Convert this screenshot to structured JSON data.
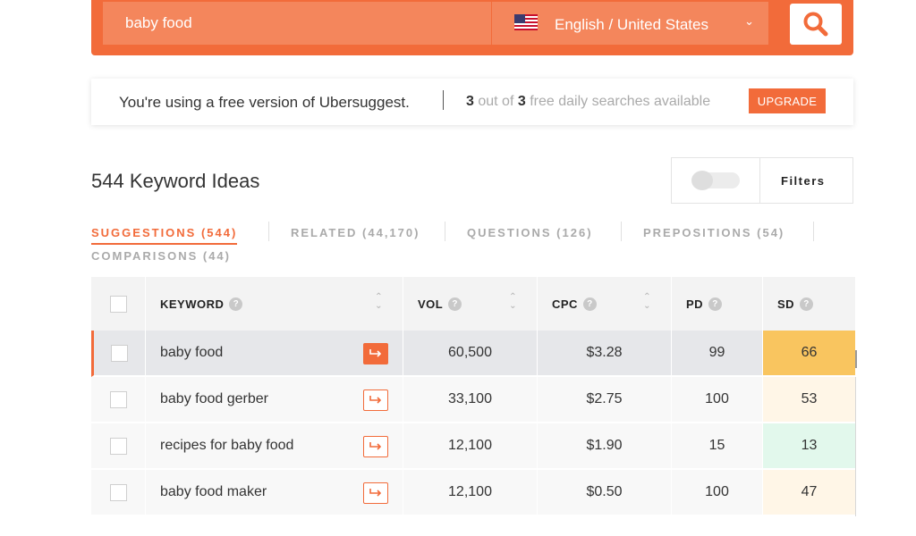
{
  "search": {
    "query": "baby food",
    "language": "English / United States",
    "flag_icon": "us-flag-icon",
    "search_icon": "search-icon"
  },
  "banner": {
    "message": "You're using a free version of Ubersuggest.",
    "used": "3",
    "out_of_text": "out of",
    "total": "3",
    "suffix": "free daily searches available",
    "upgrade_label": "UPGRADE"
  },
  "ideas": {
    "title": "544 Keyword Ideas",
    "filters_label": "Filters"
  },
  "tabs": [
    {
      "label": "SUGGESTIONS (544)",
      "active": true
    },
    {
      "label": "RELATED (44,170)",
      "active": false
    },
    {
      "label": "QUESTIONS (126)",
      "active": false
    },
    {
      "label": "PREPOSITIONS (54)",
      "active": false
    },
    {
      "label": "COMPARISONS (44)",
      "active": false
    }
  ],
  "table": {
    "headers": {
      "keyword": "KEYWORD",
      "vol": "VOL",
      "cpc": "CPC",
      "pd": "PD",
      "sd": "SD"
    },
    "rows": [
      {
        "keyword": "baby food",
        "vol": "60,500",
        "cpc": "$3.28",
        "pd": "99",
        "sd": "66"
      },
      {
        "keyword": "baby food gerber",
        "vol": "33,100",
        "cpc": "$2.75",
        "pd": "100",
        "sd": "53"
      },
      {
        "keyword": "recipes for baby food",
        "vol": "12,100",
        "cpc": "$1.90",
        "pd": "15",
        "sd": "13"
      },
      {
        "keyword": "baby food maker",
        "vol": "12,100",
        "cpc": "$0.50",
        "pd": "100",
        "sd": "47"
      }
    ]
  },
  "colors": {
    "accent": "#f26b3a",
    "sd_high": "#f9c55f",
    "sd_mid": "#fff6e7",
    "sd_low": "#e2f8ec"
  }
}
